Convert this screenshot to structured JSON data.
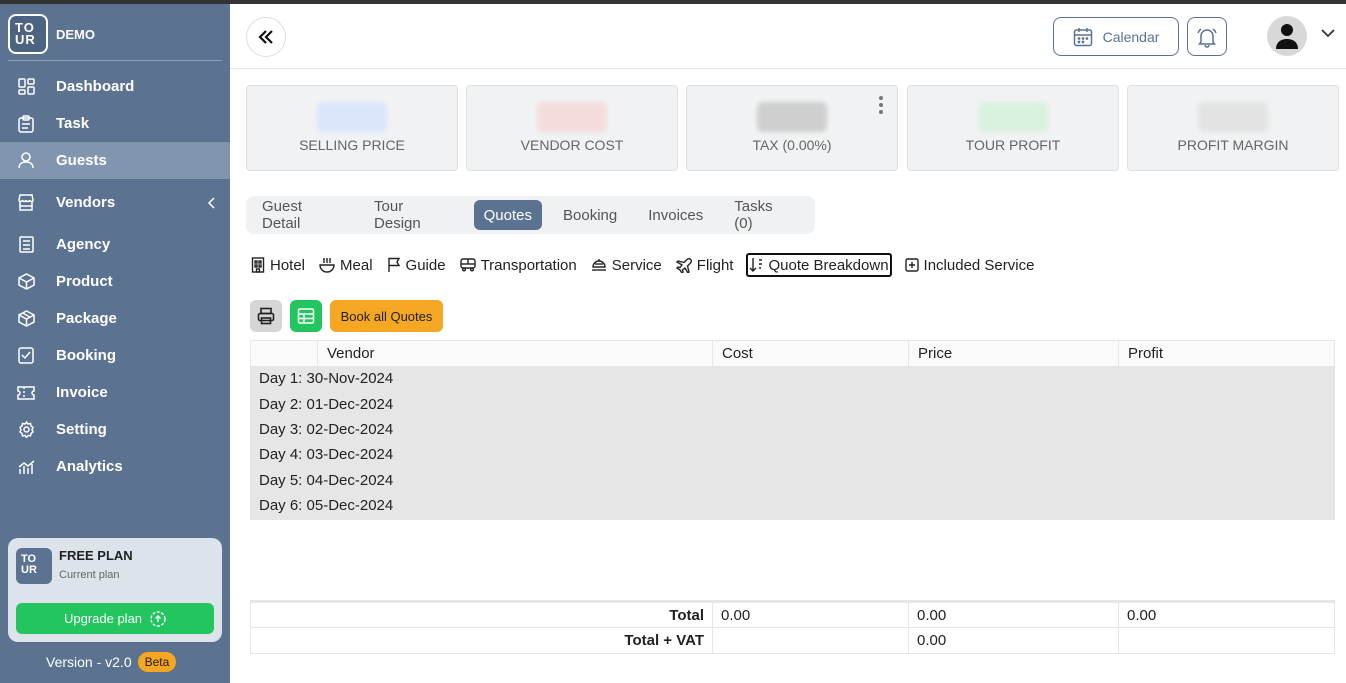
{
  "brand": {
    "logo_line1": "TO",
    "logo_line2": "UR",
    "name": "DEMO"
  },
  "sidebar": {
    "items": [
      {
        "label": "Dashboard",
        "icon": "dashboard-icon"
      },
      {
        "label": "Task",
        "icon": "clipboard-icon"
      },
      {
        "label": "Guests",
        "icon": "user-icon",
        "active": true
      },
      {
        "label": "Vendors",
        "icon": "store-icon",
        "has_submenu": true
      },
      {
        "label": "Agency",
        "icon": "building-icon"
      },
      {
        "label": "Product",
        "icon": "box-icon"
      },
      {
        "label": "Package",
        "icon": "package-icon"
      },
      {
        "label": "Booking",
        "icon": "checklist-icon"
      },
      {
        "label": "Invoice",
        "icon": "ticket-icon"
      },
      {
        "label": "Setting",
        "icon": "gear-icon"
      },
      {
        "label": "Analytics",
        "icon": "chart-icon"
      }
    ],
    "plan": {
      "title": "FREE PLAN",
      "subtitle": "Current plan",
      "upgrade_label": "Upgrade plan"
    },
    "version": "Version - v2.0",
    "beta": "Beta"
  },
  "header": {
    "calendar_label": "Calendar"
  },
  "stats": [
    {
      "label": "SELLING PRICE",
      "color": "#dbe6fb"
    },
    {
      "label": "VENDOR COST",
      "color": "#f5dcdc"
    },
    {
      "label": "TAX (0.00%)",
      "color": "#cfcfcf"
    },
    {
      "label": "TOUR PROFIT",
      "color": "#d9f1df"
    },
    {
      "label": "PROFIT MARGIN",
      "color": "#e3e3e3"
    }
  ],
  "tabs": [
    "Guest Detail",
    "Tour Design",
    "Quotes",
    "Booking",
    "Invoices",
    "Tasks (0)"
  ],
  "active_tab": "Quotes",
  "subnav": [
    "Hotel",
    "Meal",
    "Guide",
    "Transportation",
    "Service",
    "Flight",
    "Quote Breakdown",
    "Included Service"
  ],
  "actions": {
    "book_all": "Book all Quotes"
  },
  "table": {
    "columns": [
      "",
      "Vendor",
      "Cost",
      "Price",
      "Profit"
    ],
    "days": [
      "Day 1: 30-Nov-2024",
      "Day 2: 01-Dec-2024",
      "Day 3: 02-Dec-2024",
      "Day 4: 03-Dec-2024",
      "Day 5: 04-Dec-2024",
      "Day 6: 05-Dec-2024"
    ],
    "total_label": "Total",
    "total_cost": "0.00",
    "total_price": "0.00",
    "total_profit": "0.00",
    "total_vat_label": "Total + VAT",
    "total_vat_price": "0.00"
  }
}
